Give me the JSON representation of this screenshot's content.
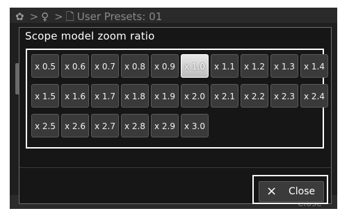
{
  "breadcrumb": {
    "icons": [
      "gear-icon",
      "person-icon",
      "document-icon"
    ],
    "separator": ">",
    "text": "User Presets: 01"
  },
  "background": {
    "close_label": "Close"
  },
  "dialog": {
    "title": "Scope model zoom ratio",
    "options": [
      "x 0.5",
      "x 0.6",
      "x 0.7",
      "x 0.8",
      "x 0.9",
      "x 1.0",
      "x 1.1",
      "x 1.2",
      "x 1.3",
      "x 1.4",
      "x 1.5",
      "x 1.6",
      "x 1.7",
      "x 1.8",
      "x 1.9",
      "x 2.0",
      "x 2.1",
      "x 2.2",
      "x 2.3",
      "x 2.4",
      "x 2.5",
      "x 2.6",
      "x 2.7",
      "x 2.8",
      "x 2.9",
      "x 3.0"
    ],
    "selected": "x 1.0",
    "close_icon": "×",
    "close_label": "Close"
  }
}
